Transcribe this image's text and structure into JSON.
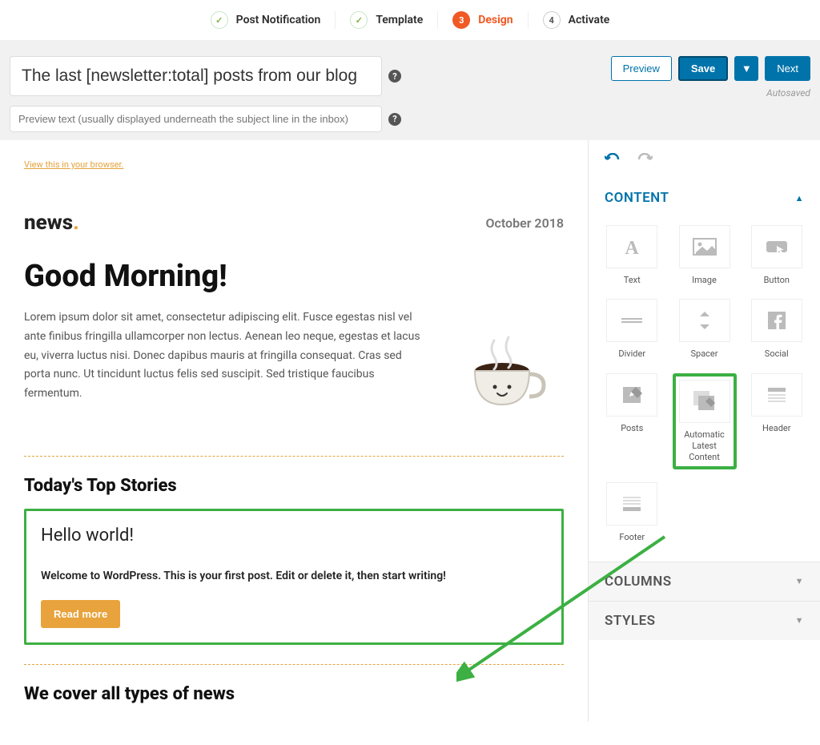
{
  "wizard": {
    "steps": [
      {
        "label": "Post Notification",
        "state": "done"
      },
      {
        "label": "Template",
        "state": "done"
      },
      {
        "label": "Design",
        "state": "current",
        "num": "3"
      },
      {
        "label": "Activate",
        "state": "future",
        "num": "4"
      }
    ]
  },
  "header": {
    "subject_value": "The last [newsletter:total] posts from our blog",
    "preview_placeholder": "Preview text (usually displayed underneath the subject line in the inbox)",
    "preview_btn": "Preview",
    "save_btn": "Save",
    "next_btn": "Next",
    "autosaved": "Autosaved"
  },
  "canvas": {
    "view_browser": "View this in your browser.",
    "logo": "news",
    "date": "October 2018",
    "greeting": "Good Morning!",
    "lorem": "Lorem ipsum dolor sit amet, consectetur adipiscing elit. Fusce egestas nisl vel ante finibus fringilla ullamcorper non lectus. Aenean leo neque, egestas et lacus eu, viverra luctus nisi. Donec dapibus mauris at fringilla consequat. Cras sed porta nunc. Ut tincidunt luctus felis sed suscipit. Sed tristique faucibus fermentum.",
    "top_stories_heading": "Today's Top Stories",
    "post_title": "Hello world!",
    "post_excerpt": "Welcome to WordPress. This is your first post. Edit or delete it, then start writing!",
    "read_more": "Read more",
    "bottom_heading": "We cover all types of news"
  },
  "sidebar": {
    "panels": {
      "content_label": "CONTENT",
      "columns_label": "COLUMNS",
      "styles_label": "STYLES"
    },
    "widgets": [
      {
        "label": "Text"
      },
      {
        "label": "Image"
      },
      {
        "label": "Button"
      },
      {
        "label": "Divider"
      },
      {
        "label": "Spacer"
      },
      {
        "label": "Social"
      },
      {
        "label": "Posts"
      },
      {
        "label": "Automatic Latest Content"
      },
      {
        "label": "Header"
      },
      {
        "label": "Footer"
      }
    ]
  },
  "colors": {
    "accent_orange": "#f05a24",
    "primary_blue": "#0073aa",
    "highlight_green": "#3cb043",
    "amber": "#e8a33d"
  }
}
